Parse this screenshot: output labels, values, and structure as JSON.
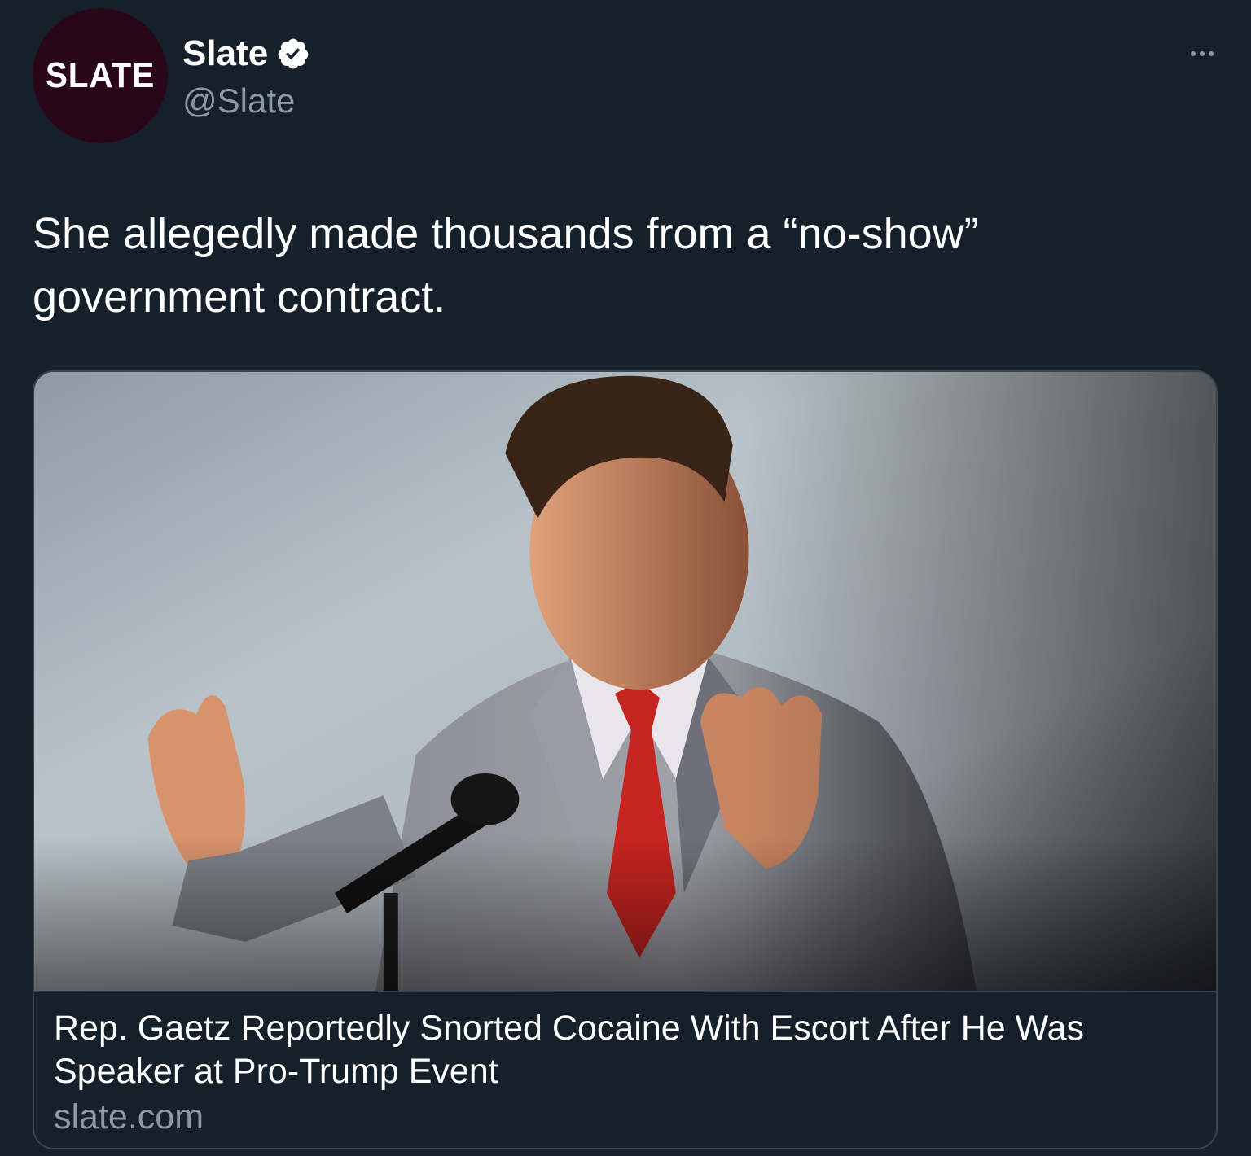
{
  "author": {
    "avatar_text": "SLATE",
    "display_name": "Slate",
    "handle": "@Slate",
    "verified": true,
    "verified_icon": "verified-badge-icon"
  },
  "more_icon": "more-options-icon",
  "tweet": {
    "text": "She allegedly made thousands from a “no-show” government contract."
  },
  "card": {
    "image_alt": "Photo of a man in a gray suit and red tie speaking at a microphone",
    "title": "Rep. Gaetz Reportedly Snorted Cocaine With Escort After He Was Speaker at Pro-Trump Event",
    "domain": "slate.com"
  },
  "colors": {
    "background": "#15202b",
    "avatar_bg": "#2a0718",
    "text_primary": "#ffffff",
    "text_secondary": "#8b98a5",
    "border": "#38444d",
    "tie_red": "#c8241f",
    "suit_gray": "#8a8f99"
  }
}
